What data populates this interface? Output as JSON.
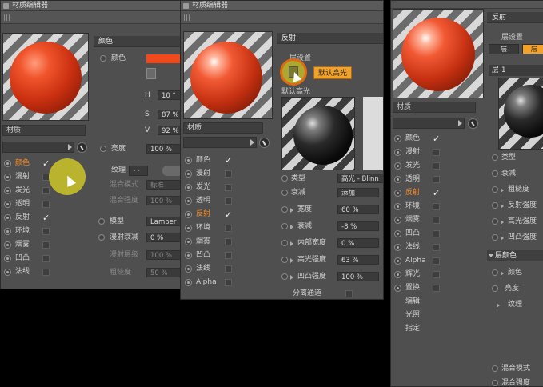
{
  "win1": {
    "title": "材质编辑器",
    "material_name": "材质",
    "channels": [
      {
        "label": "颜色",
        "checked": true,
        "active": true
      },
      {
        "label": "漫射",
        "checked": false,
        "active": false
      },
      {
        "label": "发光",
        "checked": false,
        "active": false
      },
      {
        "label": "透明",
        "checked": false,
        "active": false
      },
      {
        "label": "反射",
        "checked": true,
        "active": false
      },
      {
        "label": "环境",
        "checked": false,
        "active": false
      },
      {
        "label": "烟雾",
        "checked": false,
        "active": false
      },
      {
        "label": "凹凸",
        "checked": false,
        "active": false
      },
      {
        "label": "法线",
        "checked": false,
        "active": false
      }
    ],
    "color_section": {
      "title": "颜色",
      "color_label": "颜色",
      "color_swatch": "#f04a1c",
      "h_label": "H",
      "h_value": "10 °",
      "s_label": "S",
      "s_value": "87 %",
      "v_label": "V",
      "v_value": "92 %",
      "brightness_label": "亮度",
      "brightness_value": "100 %",
      "texture_label": "纹理",
      "blend_mode_label": "混合模式",
      "blend_mode_value": "标准",
      "blend_strength_label": "混合强度",
      "blend_strength_value": "100 %",
      "model_label": "模型",
      "model_value": "Lamber",
      "diffuse_falloff_label": "漫射衰减",
      "diffuse_falloff_value": "0 %",
      "diffuse_level_label": "漫射层级",
      "diffuse_level_value": "100 %",
      "roughness_label": "粗糙度",
      "roughness_value": "50 %"
    }
  },
  "win2": {
    "title": "材质编辑器",
    "material_name": "材质",
    "channels": [
      {
        "label": "颜色",
        "checked": true,
        "active": false
      },
      {
        "label": "漫射",
        "checked": false,
        "active": false
      },
      {
        "label": "发光",
        "checked": false,
        "active": false
      },
      {
        "label": "透明",
        "checked": false,
        "active": false
      },
      {
        "label": "反射",
        "checked": true,
        "active": true
      },
      {
        "label": "环境",
        "checked": false,
        "active": false
      },
      {
        "label": "烟雾",
        "checked": false,
        "active": false
      },
      {
        "label": "凹凸",
        "checked": false,
        "active": false
      },
      {
        "label": "法线",
        "checked": false,
        "active": false
      },
      {
        "label": "Alpha",
        "checked": false,
        "active": false
      }
    ],
    "reflect_section": {
      "title": "反射",
      "layer_settings_partial": "层设置",
      "tooltip": "默认高光",
      "default_specular_partial": "默认高光",
      "type_label": "类型",
      "type_value": "高光 - Blinn",
      "falloff_label": "衰减",
      "falloff_value": "添加",
      "width_label": "宽度",
      "width_value": "60 %",
      "decay_label": "衰减",
      "decay_value": "-8 %",
      "inner_width_label": "内部宽度",
      "inner_width_value": "0 %",
      "spec_strength_label": "高光强度",
      "spec_strength_value": "63 %",
      "bump_strength_label": "凹凸强度",
      "bump_strength_value": "100 %",
      "separate_pass_label": "分离通道"
    }
  },
  "win3": {
    "channels": [
      {
        "label": "颜色",
        "checked": true,
        "active": false
      },
      {
        "label": "漫射",
        "checked": false,
        "active": false
      },
      {
        "label": "发光",
        "checked": false,
        "active": false
      },
      {
        "label": "透明",
        "checked": false,
        "active": false
      },
      {
        "label": "反射",
        "checked": true,
        "active": true
      },
      {
        "label": "环境",
        "checked": false,
        "active": false
      },
      {
        "label": "烟雾",
        "checked": false,
        "active": false
      },
      {
        "label": "凹凸",
        "checked": false,
        "active": false
      },
      {
        "label": "法线",
        "checked": false,
        "active": false
      },
      {
        "label": "Alpha",
        "checked": false,
        "active": false
      },
      {
        "label": "辉光",
        "checked": false,
        "active": false
      },
      {
        "label": "置换",
        "checked": false,
        "active": false
      }
    ],
    "extra_items": [
      "编辑",
      "光照",
      "指定"
    ],
    "material_name": "材质",
    "reflect_section": {
      "title": "反射",
      "layer_settings": "层设置",
      "tab_a": "层",
      "tab_b": "层",
      "layer1": "层 1",
      "type_label": "类型",
      "falloff_label": "衰减",
      "roughness_label": "粗糙度",
      "reflect_strength_label": "反射强度",
      "spec_strength_label": "高光强度",
      "bump_strength_label": "凹凸强度",
      "layer_color_label": "层颜色",
      "color_label": "颜色",
      "brightness_label": "亮度",
      "texture_label": "纹理",
      "blend_mode_label": "混合模式",
      "blend_strength_label": "混合强度"
    }
  }
}
